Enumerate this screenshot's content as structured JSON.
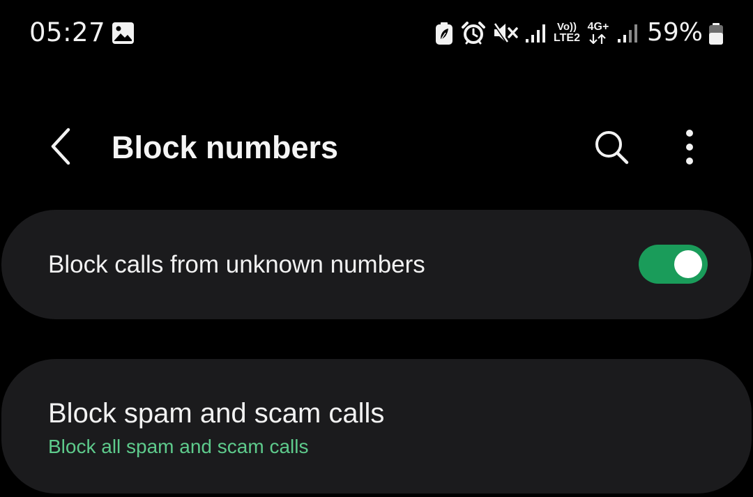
{
  "status_bar": {
    "time": "05:27",
    "network_volte": "Vo))",
    "network_lte": "LTE2",
    "network_4g": "4G+",
    "battery_percent": "59%",
    "icons": [
      "gallery-icon",
      "battery-saver-icon",
      "alarm-icon",
      "mute-icon",
      "signal-icon",
      "signal-icon",
      "battery-icon"
    ]
  },
  "header": {
    "title": "Block numbers",
    "back_icon": "back-icon",
    "search_icon": "search-icon",
    "more_icon": "more-options-icon"
  },
  "settings": {
    "unknown_numbers": {
      "label": "Block calls from unknown numbers",
      "enabled": true
    },
    "spam_calls": {
      "label": "Block spam and scam calls",
      "description": "Block all spam and scam calls"
    }
  },
  "colors": {
    "background": "#000000",
    "card": "#1b1b1d",
    "accent": "#1a9c5a",
    "accent_text": "#5ecb8c",
    "text_primary": "#f2f2f2"
  }
}
